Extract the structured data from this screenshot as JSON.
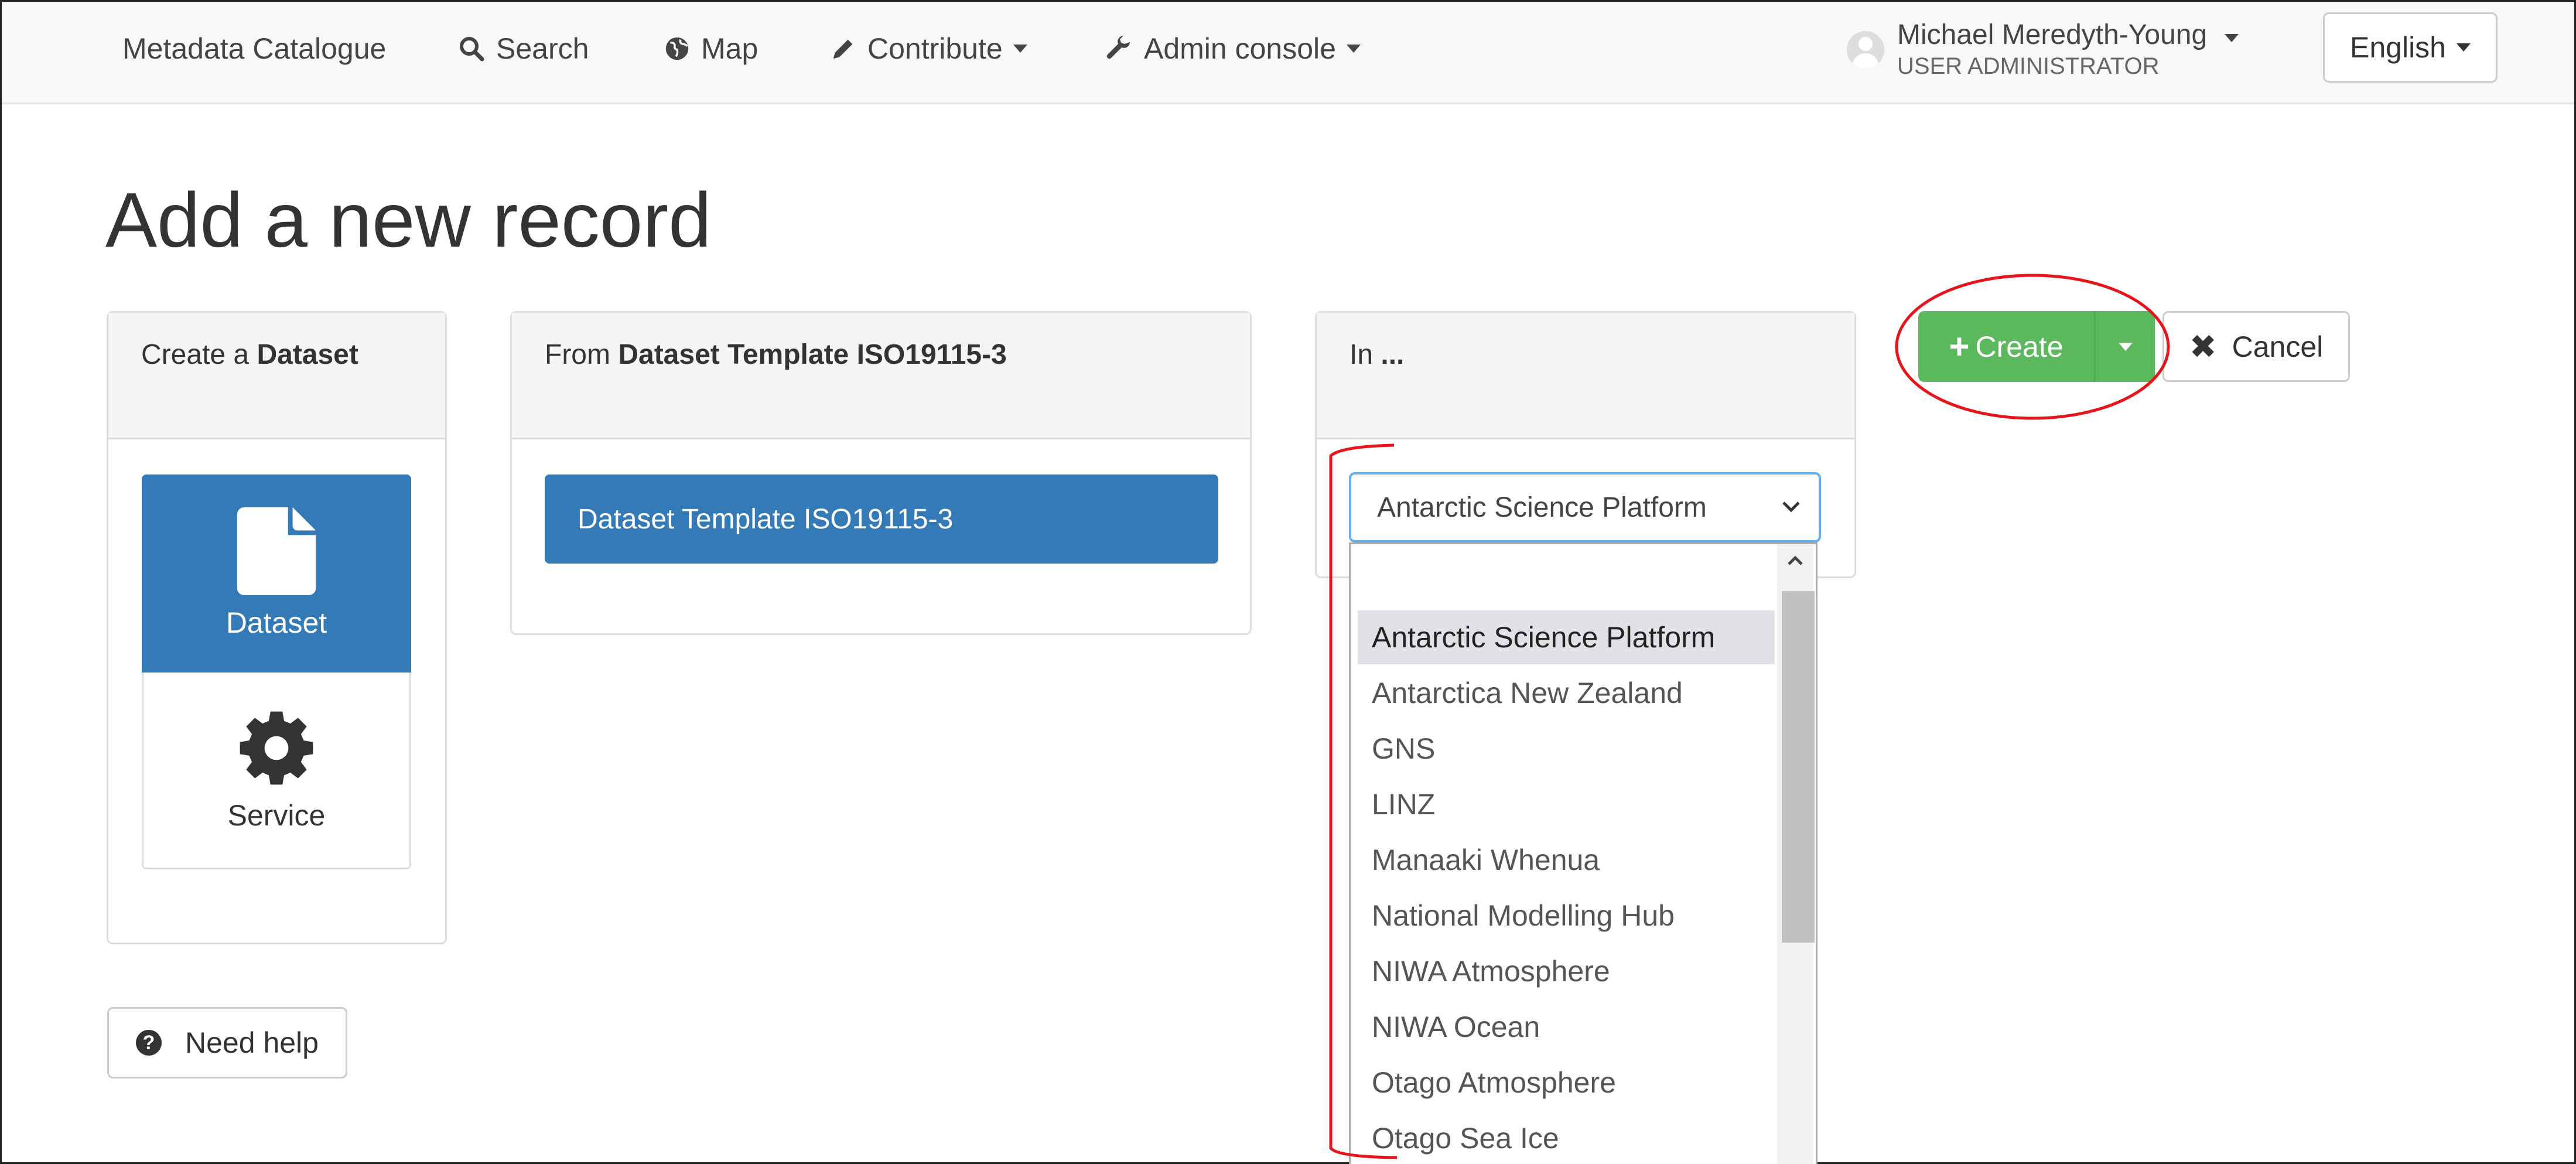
{
  "navbar": {
    "brand": "Metadata Catalogue",
    "items": [
      {
        "label": "Search",
        "icon": "search-icon"
      },
      {
        "label": "Map",
        "icon": "globe-icon"
      },
      {
        "label": "Contribute",
        "icon": "pencil-icon"
      },
      {
        "label": "Admin console",
        "icon": "wrench-icon"
      }
    ],
    "user": {
      "name": "Michael Meredyth-Young",
      "role": "USER ADMINISTRATOR"
    },
    "language": "English"
  },
  "page": {
    "title": "Add a new record",
    "type_panel": {
      "heading_prefix": "Create a ",
      "heading_bold": "Dataset",
      "options": [
        {
          "label": "Dataset",
          "icon": "file-icon",
          "selected": true
        },
        {
          "label": "Service",
          "icon": "gear-icon",
          "selected": false
        }
      ]
    },
    "template_panel": {
      "heading_prefix": "From ",
      "heading_bold": "Dataset Template ISO19115-3",
      "templates": [
        "Dataset Template ISO19115-3"
      ]
    },
    "group_panel": {
      "heading_prefix": "In ",
      "heading_bold": "...",
      "selected": "Antarctic Science Platform",
      "options": [
        "Antarctic Science Platform",
        "Antarctica New Zealand",
        "GNS",
        "LINZ",
        "Manaaki Whenua",
        "National Modelling Hub",
        "NIWA Atmosphere",
        "NIWA Ocean",
        "Otago Atmosphere",
        "Otago Sea Ice"
      ]
    },
    "actions": {
      "create": "Create",
      "cancel": "Cancel",
      "help": "Need help"
    }
  },
  "colors": {
    "primary": "#337ab7",
    "success": "#5cb85c",
    "annotation": "#e8141c"
  }
}
